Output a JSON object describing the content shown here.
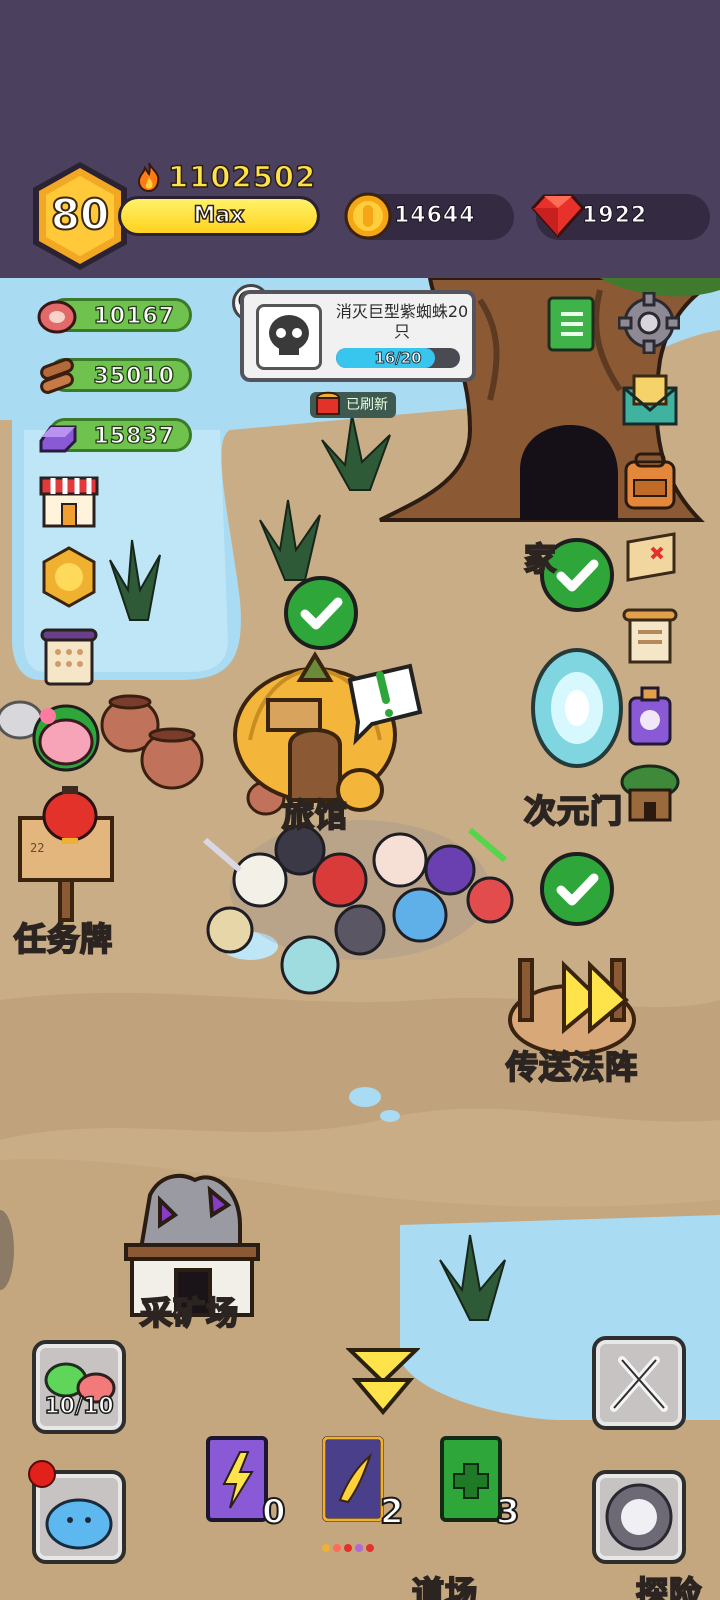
{
  "header": {
    "level": "80",
    "power": "1102502",
    "exp_label": "Max",
    "exp_fraction": 1.0,
    "coins": "14644",
    "gems": "1922"
  },
  "resources": [
    {
      "name": "meat",
      "icon": "meat-icon",
      "value": "10167"
    },
    {
      "name": "wood",
      "icon": "wood-log-icon",
      "value": "35010"
    },
    {
      "name": "ore",
      "icon": "purple-ingot-icon",
      "value": "15837"
    }
  ],
  "quest": {
    "title": "消灭巨型紫蜘蛛20只",
    "progress_text": "16/20",
    "progress_fraction": 0.8,
    "refresh_label": "已刷新"
  },
  "places": {
    "inn": "旅馆",
    "portal": "次元门",
    "home": "家",
    "task_board": "任务牌",
    "teleport": "传送法阵",
    "mine": "采矿场",
    "dojo": "道场",
    "explore": "探险"
  },
  "bottom": {
    "slime_counter": "10/10",
    "books": [
      {
        "icon": "purple-lightning-book-icon",
        "count": "0"
      },
      {
        "icon": "gold-wing-book-icon",
        "count": "2"
      },
      {
        "icon": "green-cross-book-icon",
        "count": "3"
      }
    ]
  },
  "colors": {
    "header_bg": "#4b415f",
    "ground": "#c9ad86",
    "water": "#a9dbf2",
    "check_green": "#2ea63a",
    "exp_yellow": "#ffd21e",
    "resource_green": "#6fc24e"
  }
}
